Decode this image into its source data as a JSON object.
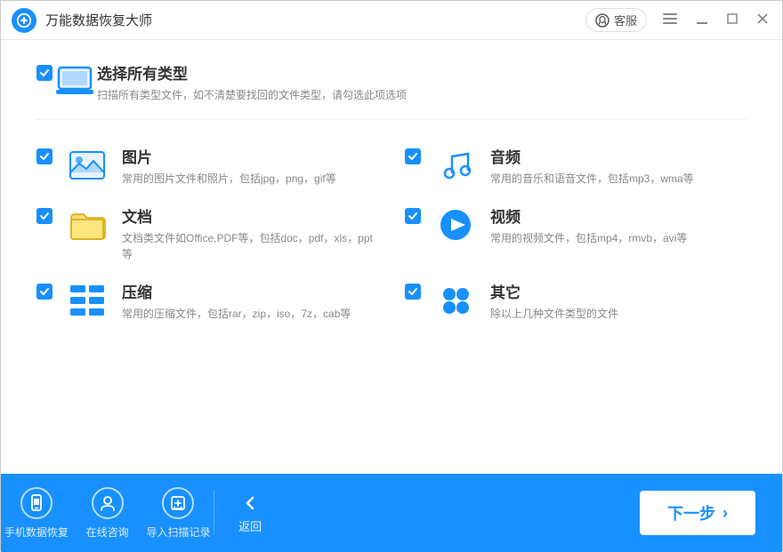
{
  "titleBar": {
    "logoAlt": "万能数据恢复大师",
    "title": "万能数据恢复大师",
    "serviceLabel": "客服",
    "minimizeBtn": "—",
    "restoreBtn": "□",
    "closeBtn": "✕"
  },
  "selectAll": {
    "label": "选择所有类型",
    "desc": "扫描所有类型文件，如不清楚要找回的文件类型，请勾选此项选项"
  },
  "fileTypes": [
    {
      "id": "image",
      "name": "图片",
      "desc": "常用的图片文件和照片，包括jpg，png，gif等",
      "iconType": "image",
      "checked": true,
      "col": 0
    },
    {
      "id": "audio",
      "name": "音频",
      "desc": "常用的音乐和语音文件，包括mp3，wma等",
      "iconType": "audio",
      "checked": true,
      "col": 1
    },
    {
      "id": "document",
      "name": "文档",
      "desc": "文档类文件如Office,PDF等，包括doc，pdf，xls，ppt等",
      "iconType": "document",
      "checked": true,
      "col": 0
    },
    {
      "id": "video",
      "name": "视频",
      "desc": "常用的视频文件，包括mp4，rmvb，avi等",
      "iconType": "video",
      "checked": true,
      "col": 1
    },
    {
      "id": "compress",
      "name": "压缩",
      "desc": "常用的压缩文件，包括rar，zip，iso，7z，cab等",
      "iconType": "compress",
      "checked": true,
      "col": 0
    },
    {
      "id": "other",
      "name": "其它",
      "desc": "除以上几种文件类型的文件",
      "iconType": "other",
      "checked": true,
      "col": 1
    }
  ],
  "bottomNav": {
    "items": [
      {
        "id": "mobile",
        "label": "手机数据恢复",
        "iconType": "mobile"
      },
      {
        "id": "consult",
        "label": "在线咨询",
        "iconType": "person"
      },
      {
        "id": "import",
        "label": "导入扫描记录",
        "iconType": "import"
      }
    ],
    "backLabel": "返回",
    "nextLabel": "下一步"
  }
}
